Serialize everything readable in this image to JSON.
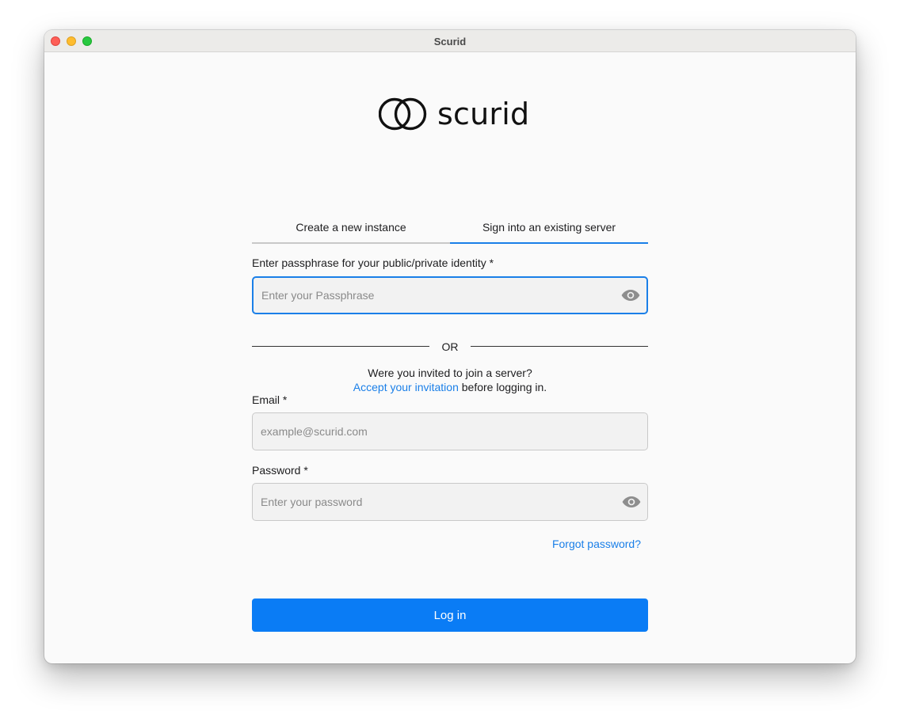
{
  "window": {
    "title": "Scurid"
  },
  "logo": {
    "text": "scurid"
  },
  "tabs": [
    {
      "label": "Create a new instance",
      "active": false
    },
    {
      "label": "Sign into an existing server",
      "active": true
    }
  ],
  "passphrase": {
    "label": "Enter passphrase for your public/private identity *",
    "placeholder": "Enter your Passphrase",
    "value": ""
  },
  "divider": {
    "text": "OR"
  },
  "invite": {
    "question": "Were you invited to join a server?",
    "link": "Accept your invitation",
    "suffix": " before logging in."
  },
  "email": {
    "label": "Email *",
    "placeholder": "example@scurid.com",
    "value": ""
  },
  "password": {
    "label": "Password *",
    "placeholder": "Enter your password",
    "value": ""
  },
  "forgot": {
    "label": "Forgot password?"
  },
  "login": {
    "label": "Log in"
  },
  "colors": {
    "accent": "#1a7fe8",
    "button": "#0a7cf5"
  }
}
